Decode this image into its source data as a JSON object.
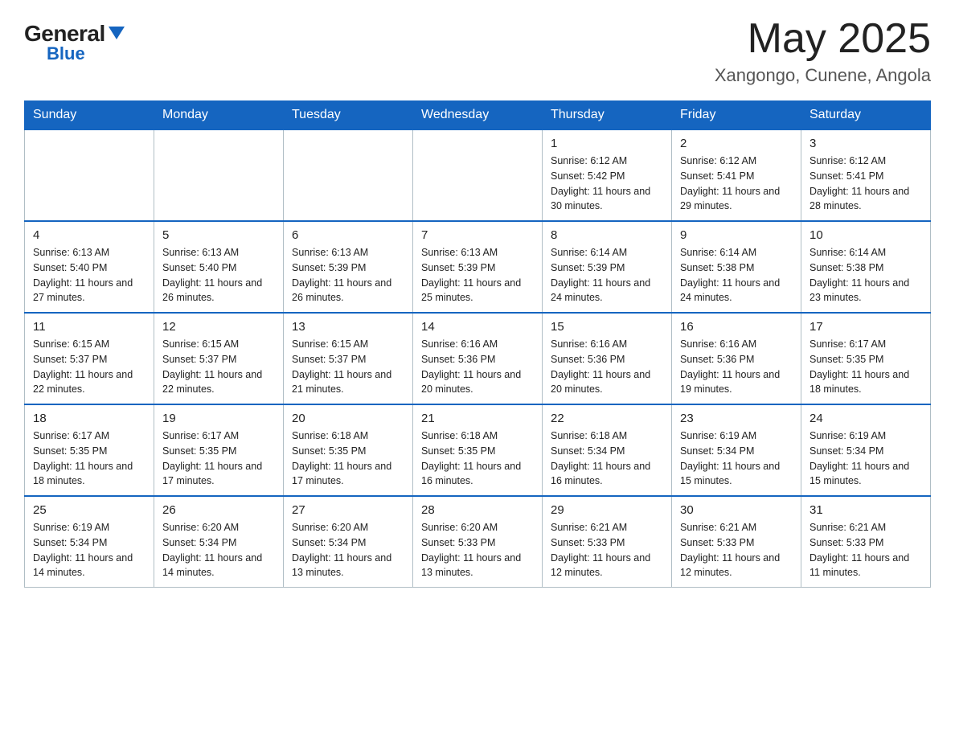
{
  "header": {
    "logo_general": "General",
    "logo_blue": "Blue",
    "month_year": "May 2025",
    "location": "Xangongo, Cunene, Angola"
  },
  "days_of_week": [
    "Sunday",
    "Monday",
    "Tuesday",
    "Wednesday",
    "Thursday",
    "Friday",
    "Saturday"
  ],
  "weeks": [
    [
      {
        "day": "",
        "info": ""
      },
      {
        "day": "",
        "info": ""
      },
      {
        "day": "",
        "info": ""
      },
      {
        "day": "",
        "info": ""
      },
      {
        "day": "1",
        "info": "Sunrise: 6:12 AM\nSunset: 5:42 PM\nDaylight: 11 hours and 30 minutes."
      },
      {
        "day": "2",
        "info": "Sunrise: 6:12 AM\nSunset: 5:41 PM\nDaylight: 11 hours and 29 minutes."
      },
      {
        "day": "3",
        "info": "Sunrise: 6:12 AM\nSunset: 5:41 PM\nDaylight: 11 hours and 28 minutes."
      }
    ],
    [
      {
        "day": "4",
        "info": "Sunrise: 6:13 AM\nSunset: 5:40 PM\nDaylight: 11 hours and 27 minutes."
      },
      {
        "day": "5",
        "info": "Sunrise: 6:13 AM\nSunset: 5:40 PM\nDaylight: 11 hours and 26 minutes."
      },
      {
        "day": "6",
        "info": "Sunrise: 6:13 AM\nSunset: 5:39 PM\nDaylight: 11 hours and 26 minutes."
      },
      {
        "day": "7",
        "info": "Sunrise: 6:13 AM\nSunset: 5:39 PM\nDaylight: 11 hours and 25 minutes."
      },
      {
        "day": "8",
        "info": "Sunrise: 6:14 AM\nSunset: 5:39 PM\nDaylight: 11 hours and 24 minutes."
      },
      {
        "day": "9",
        "info": "Sunrise: 6:14 AM\nSunset: 5:38 PM\nDaylight: 11 hours and 24 minutes."
      },
      {
        "day": "10",
        "info": "Sunrise: 6:14 AM\nSunset: 5:38 PM\nDaylight: 11 hours and 23 minutes."
      }
    ],
    [
      {
        "day": "11",
        "info": "Sunrise: 6:15 AM\nSunset: 5:37 PM\nDaylight: 11 hours and 22 minutes."
      },
      {
        "day": "12",
        "info": "Sunrise: 6:15 AM\nSunset: 5:37 PM\nDaylight: 11 hours and 22 minutes."
      },
      {
        "day": "13",
        "info": "Sunrise: 6:15 AM\nSunset: 5:37 PM\nDaylight: 11 hours and 21 minutes."
      },
      {
        "day": "14",
        "info": "Sunrise: 6:16 AM\nSunset: 5:36 PM\nDaylight: 11 hours and 20 minutes."
      },
      {
        "day": "15",
        "info": "Sunrise: 6:16 AM\nSunset: 5:36 PM\nDaylight: 11 hours and 20 minutes."
      },
      {
        "day": "16",
        "info": "Sunrise: 6:16 AM\nSunset: 5:36 PM\nDaylight: 11 hours and 19 minutes."
      },
      {
        "day": "17",
        "info": "Sunrise: 6:17 AM\nSunset: 5:35 PM\nDaylight: 11 hours and 18 minutes."
      }
    ],
    [
      {
        "day": "18",
        "info": "Sunrise: 6:17 AM\nSunset: 5:35 PM\nDaylight: 11 hours and 18 minutes."
      },
      {
        "day": "19",
        "info": "Sunrise: 6:17 AM\nSunset: 5:35 PM\nDaylight: 11 hours and 17 minutes."
      },
      {
        "day": "20",
        "info": "Sunrise: 6:18 AM\nSunset: 5:35 PM\nDaylight: 11 hours and 17 minutes."
      },
      {
        "day": "21",
        "info": "Sunrise: 6:18 AM\nSunset: 5:35 PM\nDaylight: 11 hours and 16 minutes."
      },
      {
        "day": "22",
        "info": "Sunrise: 6:18 AM\nSunset: 5:34 PM\nDaylight: 11 hours and 16 minutes."
      },
      {
        "day": "23",
        "info": "Sunrise: 6:19 AM\nSunset: 5:34 PM\nDaylight: 11 hours and 15 minutes."
      },
      {
        "day": "24",
        "info": "Sunrise: 6:19 AM\nSunset: 5:34 PM\nDaylight: 11 hours and 15 minutes."
      }
    ],
    [
      {
        "day": "25",
        "info": "Sunrise: 6:19 AM\nSunset: 5:34 PM\nDaylight: 11 hours and 14 minutes."
      },
      {
        "day": "26",
        "info": "Sunrise: 6:20 AM\nSunset: 5:34 PM\nDaylight: 11 hours and 14 minutes."
      },
      {
        "day": "27",
        "info": "Sunrise: 6:20 AM\nSunset: 5:34 PM\nDaylight: 11 hours and 13 minutes."
      },
      {
        "day": "28",
        "info": "Sunrise: 6:20 AM\nSunset: 5:33 PM\nDaylight: 11 hours and 13 minutes."
      },
      {
        "day": "29",
        "info": "Sunrise: 6:21 AM\nSunset: 5:33 PM\nDaylight: 11 hours and 12 minutes."
      },
      {
        "day": "30",
        "info": "Sunrise: 6:21 AM\nSunset: 5:33 PM\nDaylight: 11 hours and 12 minutes."
      },
      {
        "day": "31",
        "info": "Sunrise: 6:21 AM\nSunset: 5:33 PM\nDaylight: 11 hours and 11 minutes."
      }
    ]
  ]
}
